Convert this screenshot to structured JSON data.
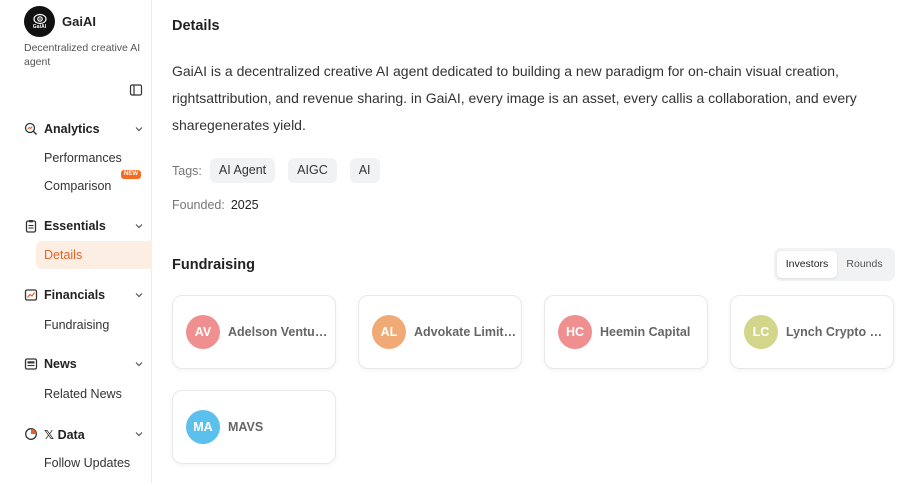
{
  "brand": {
    "name": "GaiAI",
    "logo_text": "GaiAI",
    "description": "Decentralized creative AI agent"
  },
  "sidebar": {
    "sections": [
      {
        "label": "Analytics",
        "icon": "search-chart-icon",
        "items": [
          "Performances",
          "Comparison"
        ]
      },
      {
        "label": "Essentials",
        "icon": "clipboard-icon",
        "items": [
          "Details"
        ]
      },
      {
        "label": "Financials",
        "icon": "chart-line-icon",
        "items": [
          "Fundraising"
        ]
      },
      {
        "label": "News",
        "icon": "newspaper-icon",
        "items": [
          "Related News"
        ]
      },
      {
        "label": "Data",
        "icon": "pie-chart-icon",
        "prefix": "𝕏",
        "items": [
          "Follow Updates"
        ]
      }
    ],
    "new_badge": "NEW",
    "active_item": "Details"
  },
  "main": {
    "title": "Details",
    "description": "GaiAI is a decentralized creative AI agent dedicated to building a new paradigm for on-chain visual creation, rightsattribution, and revenue sharing. in GaiAI, every image is an asset, every callis a collaboration, and every sharegenerates yield.",
    "tags_label": "Tags:",
    "tags": [
      "AI Agent",
      "AIGC",
      "AI"
    ],
    "founded_label": "Founded:",
    "founded_value": "2025"
  },
  "fundraising": {
    "title": "Fundraising",
    "tabs": [
      "Investors",
      "Rounds"
    ],
    "active_tab": "Investors",
    "investors": [
      {
        "initials": "AV",
        "name": "Adelson Ventures",
        "color": "#ef8f8f"
      },
      {
        "initials": "AL",
        "name": "Advokate Limited",
        "color": "#f0aa76"
      },
      {
        "initials": "HC",
        "name": "Heemin Capital",
        "color": "#ef8f8f"
      },
      {
        "initials": "LC",
        "name": "Lynch Crypto Capital",
        "color": "#d2d58a"
      },
      {
        "initials": "MA",
        "name": "MAVS",
        "color": "#5bc0ec"
      }
    ]
  },
  "colors": {
    "accent": "#e0642a",
    "active_bg": "#fdeee4",
    "badge": "#f36c21"
  }
}
